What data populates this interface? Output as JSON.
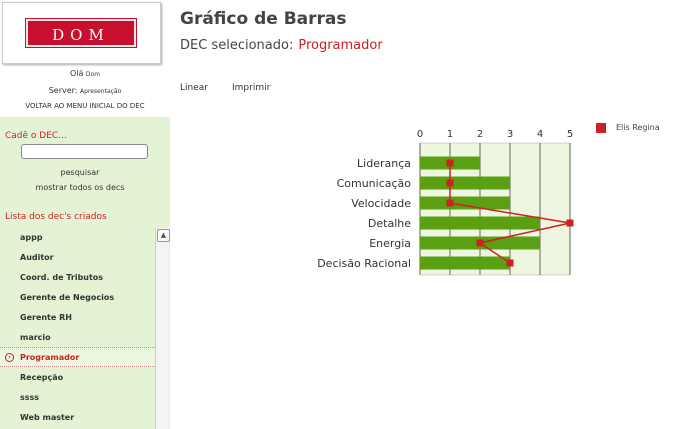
{
  "logo_text": "DOM",
  "greeting": {
    "prefix": "Olá",
    "user": "Dom"
  },
  "server": {
    "prefix": "Server:",
    "name": "Apresentação"
  },
  "back_link": "VOLTAR AO MENU INICIAL DO DEC",
  "search_section": {
    "title": "Cadê o DEC...",
    "input_value": "",
    "search_link": "pesquisar",
    "show_all_link": "mostrar todos os decs"
  },
  "list_section": {
    "title": "Lista dos dec's criados",
    "items": [
      "appp",
      "Auditor",
      "Coord. de Tributos",
      "Gerente de Negocios",
      "Gerente RH",
      "marcio",
      "Programador",
      "Recepção",
      "ssss",
      "Web master"
    ],
    "selected": "Programador"
  },
  "page_title": "Gráfico de Barras",
  "dec_selected": {
    "label": "DEC selecionado:",
    "value": "Programador"
  },
  "tabs": [
    "Linear",
    "Imprimir"
  ],
  "chart_data": {
    "type": "bar",
    "orientation": "horizontal",
    "categories": [
      "Liderança",
      "Comunicação",
      "Velocidade",
      "Detalhe",
      "Energia",
      "Decisão Racional"
    ],
    "values": [
      2,
      3,
      3,
      4,
      4,
      3
    ],
    "xlim": [
      0,
      5
    ],
    "ticks": [
      "0",
      "1",
      "2",
      "3",
      "4",
      "5"
    ],
    "grid": true,
    "bar_color": "#5aa012",
    "overlay_series": {
      "name": "Elis Regina",
      "type": "line",
      "color": "#cc2222",
      "values": [
        1,
        1,
        1,
        5,
        2,
        3
      ]
    },
    "legend_position": "top-right"
  }
}
